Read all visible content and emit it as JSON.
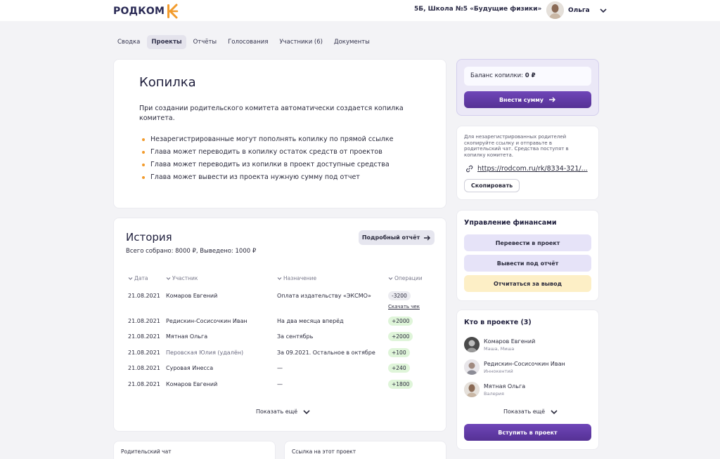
{
  "header": {
    "logo_text": "РОДКОМ",
    "school": "5Б, Школа №5 «Будущие физики»",
    "user_name": "Ольга"
  },
  "tabs": [
    {
      "label": "Сводка",
      "active": false
    },
    {
      "label": "Проекты",
      "active": true
    },
    {
      "label": "Отчёты",
      "active": false
    },
    {
      "label": "Голосования",
      "active": false
    },
    {
      "label": "Участники (6)",
      "active": false
    },
    {
      "label": "Документы",
      "active": false
    }
  ],
  "kopilka": {
    "title": "Копилка",
    "intro": "При создании родительского комитета автоматически создается копилка комитета.",
    "bullets": [
      "Незарегистрированные могут пополнять копилку по прямой ссылке",
      "Глава может переводить в копилку остаток средств от проектов",
      "Глава может переводить из копилки в проект доступные средства",
      "Глава может вывести из проекта нужную сумму под отчет"
    ]
  },
  "history": {
    "title": "История",
    "summary": "Всего собрано: 8000 ₽, Выведено: 1000 ₽",
    "report_button": "Подробный отчёт",
    "columns": [
      "Дата",
      "Участник",
      "Назначение",
      "Операции"
    ],
    "rows": [
      {
        "date": "21.08.2021",
        "member": "Комаров Евгений",
        "purpose": "Оплата издательству «ЭКСМО»",
        "amount": "-3200",
        "receipt": "Скачать чек"
      },
      {
        "date": "21.08.2021",
        "member": "Редискин-Сосисочкин Иван",
        "purpose": "На два месяца вперёд",
        "amount": "+2000"
      },
      {
        "date": "21.08.2021",
        "member": "Мятная Ольга",
        "purpose": "За сентябрь",
        "amount": "+2000"
      },
      {
        "date": "21.08.2021",
        "member": "Перовская Юлия (удалён)",
        "purpose": "За 09.2021. Остальное в октябре",
        "amount": "+100",
        "deleted": true
      },
      {
        "date": "21.08.2021",
        "member": "Суровая Инесса",
        "purpose": "—",
        "amount": "+240"
      },
      {
        "date": "21.08.2021",
        "member": "Комаров Евгений",
        "purpose": "—",
        "amount": "+1800"
      }
    ],
    "show_more": "Показать ещё"
  },
  "balance": {
    "label": "Баланс копилки:",
    "value": "0 ₽",
    "deposit_button": "Внести сумму"
  },
  "link_card": {
    "note": "Для незарегистрированных родителей скопируйте ссылку и отправьте в родительский чат. Средства поступят в копилку комитета.",
    "url": "https://rodcom.ru/rk/8334-321/...",
    "copy_button": "Скопировать"
  },
  "finance": {
    "title": "Управление финансами",
    "transfer_button": "Перевести в проект",
    "withdraw_button": "Вывести под отчёт",
    "report_button": "Отчитаться за вывод"
  },
  "who": {
    "title": "Кто в проекте (3)",
    "members": [
      {
        "name": "Комаров Евгений",
        "kids": "Маша, Миша"
      },
      {
        "name": "Редискин-Сосисочкин Иван",
        "kids": "Иннокентий"
      },
      {
        "name": "Мятная Ольга",
        "kids": "Валерия"
      }
    ],
    "show_more": "Показать ещё",
    "join_button": "Вступить в проект"
  },
  "bottom": {
    "parent_chat": "Родительский чат",
    "project_link": "Ссылка на этот проект"
  },
  "colors": {
    "accent": "#553195",
    "bullet": "#f29b2c",
    "positive_bg": "#dff5d9",
    "warning_bg": "#fdefc6"
  }
}
